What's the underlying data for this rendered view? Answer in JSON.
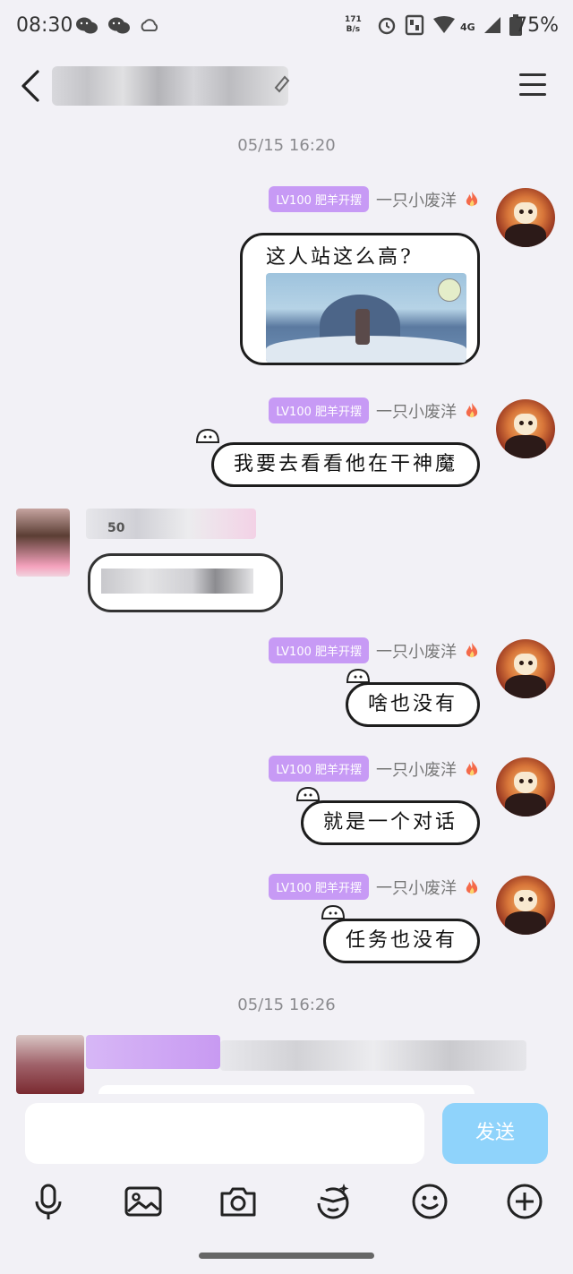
{
  "status_bar": {
    "time": "08:30",
    "net_speed_value": "171",
    "net_speed_unit": "B/s",
    "network": "4G",
    "battery": "75%"
  },
  "header": {
    "back_icon": "chevron-left-icon",
    "menu_icon": "hamburger-menu-icon"
  },
  "timestamps": [
    "05/15 16:20",
    "05/15 16:26"
  ],
  "user": {
    "badge": "LV100 肥羊开摆",
    "nickname": "一只小废洋"
  },
  "messages": [
    {
      "text": "这人站这么高?",
      "has_image": true
    },
    {
      "text": "我要去看看他在干神魔"
    },
    {
      "text": "啥也没有"
    },
    {
      "text": "就是一个对话"
    },
    {
      "text": "任务也没有"
    }
  ],
  "incoming_partial": "50",
  "input": {
    "placeholder": "",
    "send_label": "发送"
  },
  "toolbar": {
    "icons": [
      "microphone-icon",
      "image-icon",
      "camera-icon",
      "sticker-icon",
      "emoji-icon",
      "plus-icon"
    ]
  },
  "colors": {
    "background": "#f2f1f6",
    "badge": "#c79af5",
    "send_button": "#8fd3fb"
  }
}
